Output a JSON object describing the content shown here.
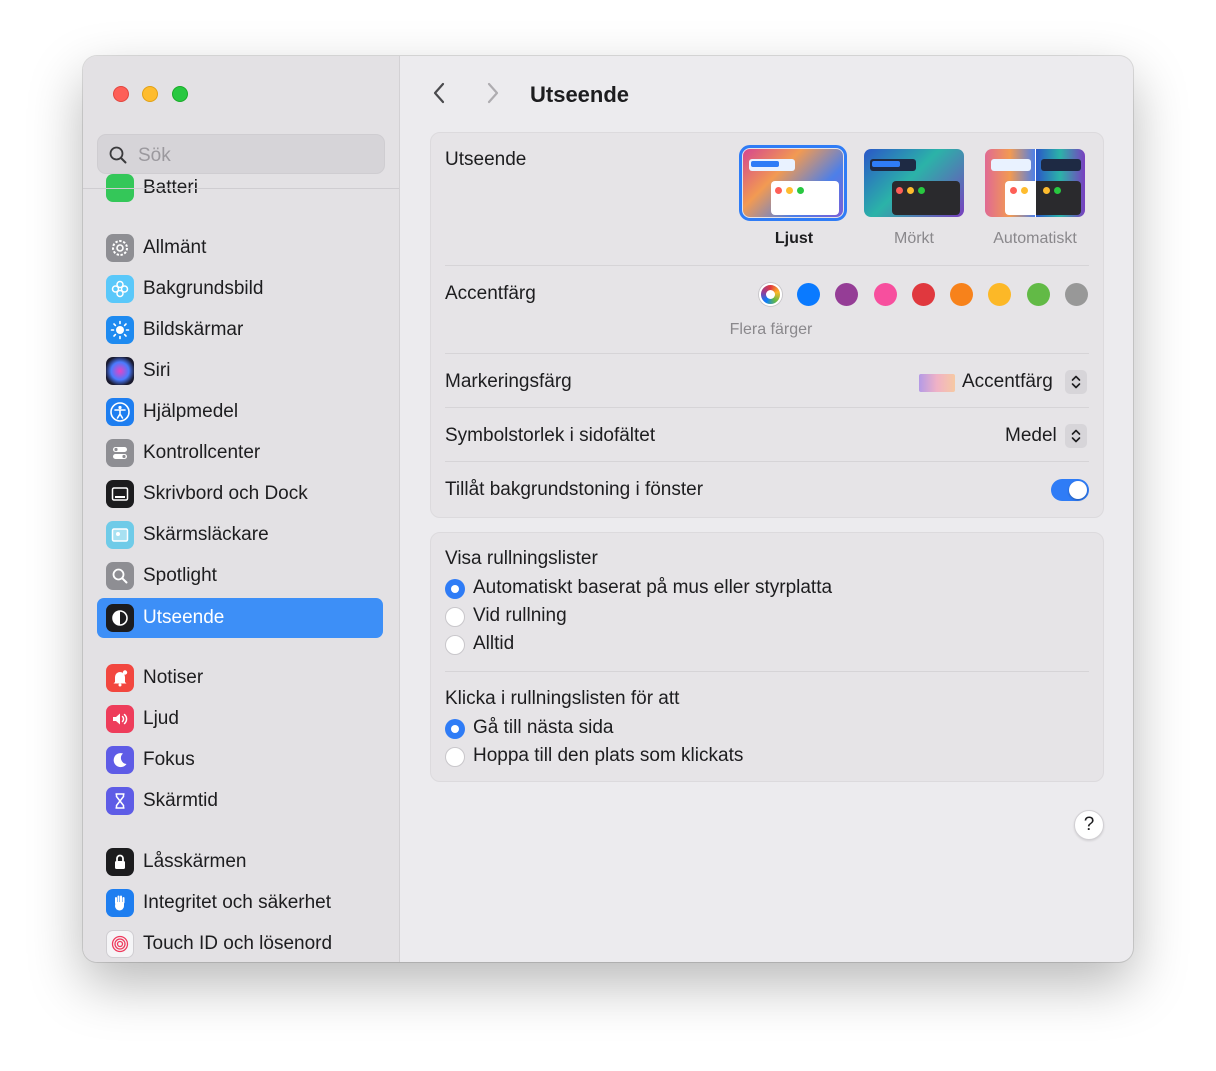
{
  "window": {
    "title": "Utseende"
  },
  "search": {
    "placeholder": "Sök"
  },
  "sidebar": {
    "partial_item": "Batteri",
    "items": [
      {
        "label": "Allmänt",
        "icon": "gear-icon",
        "color": "#8e8e93"
      },
      {
        "label": "Bakgrundsbild",
        "icon": "flower-icon",
        "color": "#5ac8fa"
      },
      {
        "label": "Bildskärmar",
        "icon": "sun-icon",
        "color": "#1e8af0"
      },
      {
        "label": "Siri",
        "icon": "siri-icon",
        "color": "#1c1c2e"
      },
      {
        "label": "Hjälpmedel",
        "icon": "accessibility-icon",
        "color": "#1e7ef0"
      },
      {
        "label": "Kontrollcenter",
        "icon": "toggles-icon",
        "color": "#8e8e93"
      },
      {
        "label": "Skrivbord och Dock",
        "icon": "dock-icon",
        "color": "#1c1c1e"
      },
      {
        "label": "Skärmsläckare",
        "icon": "screensaver-icon",
        "color": "#6fcbe8"
      },
      {
        "label": "Spotlight",
        "icon": "magnifier-icon",
        "color": "#8e8e93"
      },
      {
        "label": "Utseende",
        "icon": "appearance-icon",
        "color": "#1c1c1e"
      },
      {
        "label": "Notiser",
        "icon": "bell-icon",
        "color": "#f2473f"
      },
      {
        "label": "Ljud",
        "icon": "speaker-icon",
        "color": "#ee3d5b"
      },
      {
        "label": "Fokus",
        "icon": "moon-icon",
        "color": "#5e5ce6"
      },
      {
        "label": "Skärmtid",
        "icon": "hourglass-icon",
        "color": "#5e5ce6"
      },
      {
        "label": "Låsskärmen",
        "icon": "lock-icon",
        "color": "#1c1c1e"
      },
      {
        "label": "Integritet och säkerhet",
        "icon": "hand-icon",
        "color": "#1e7ef0"
      },
      {
        "label": "Touch ID och lösenord",
        "icon": "fingerprint-icon",
        "color": "#f5f5f7"
      }
    ]
  },
  "main": {
    "title": "Utseende",
    "appearance": {
      "label": "Utseende",
      "options": [
        "Ljust",
        "Mörkt",
        "Automatiskt"
      ],
      "selected": "Ljust"
    },
    "accent": {
      "label": "Accentfärg",
      "caption": "Flera färger",
      "colors": [
        "multicolor",
        "#0a7aff",
        "#953d96",
        "#f74f9e",
        "#e0383e",
        "#f7821b",
        "#fcb827",
        "#62ba46",
        "#989898"
      ]
    },
    "highlight": {
      "label": "Markeringsfärg",
      "value": "Accentfärg"
    },
    "sidebar_icon_size": {
      "label": "Symbolstorlek i sidofältet",
      "value": "Medel"
    },
    "tinting": {
      "label": "Tillåt bakgrundstoning i fönster",
      "enabled": true
    },
    "scrollbars": {
      "label": "Visa rullningslister",
      "options": [
        "Automatiskt baserat på mus eller styrplatta",
        "Vid rullning",
        "Alltid"
      ],
      "selected": 0
    },
    "scroll_click": {
      "label": "Klicka i rullningslisten för att",
      "options": [
        "Gå till nästa sida",
        "Hoppa till den plats som klickats"
      ],
      "selected": 0
    },
    "help": "?"
  }
}
